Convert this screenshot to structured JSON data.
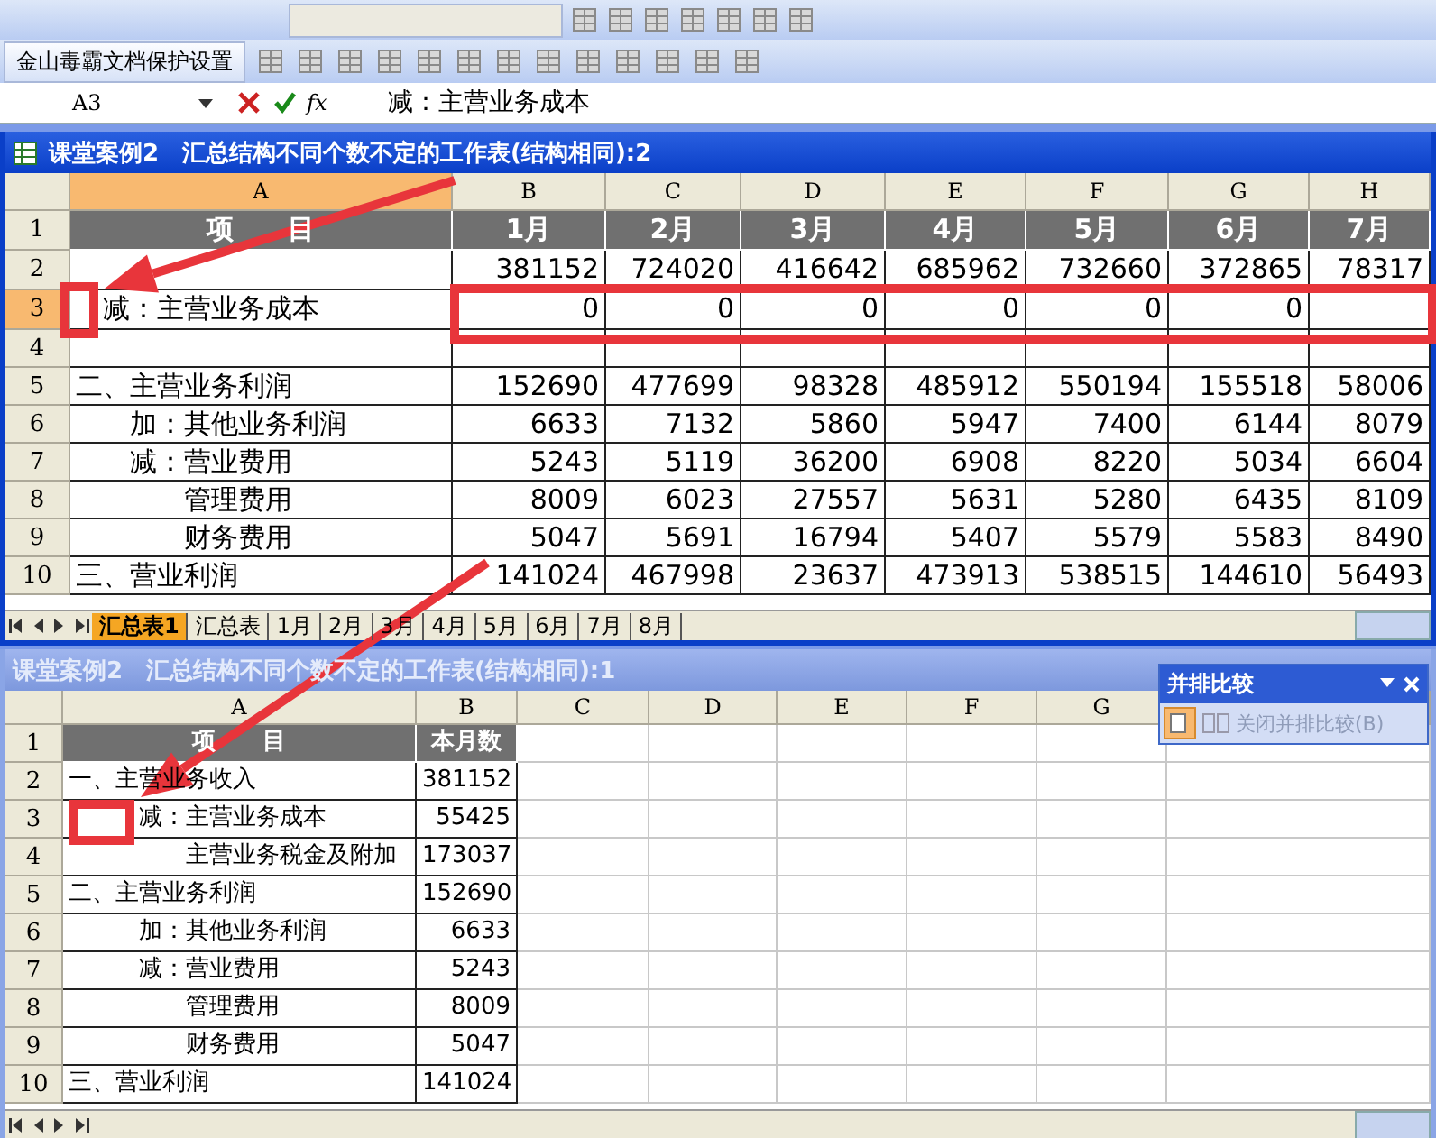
{
  "toolbar": {
    "label": "金山毒霸文档保护设置"
  },
  "formula_bar": {
    "cell_ref": "A3",
    "function_label": "fx",
    "formula": "减：主营业务成本"
  },
  "windows": [
    {
      "title": "课堂案例2　汇总结构不同个数不定的工作表(结构相同):2",
      "active": true,
      "columns": [
        {
          "label": "A",
          "selected": true
        },
        {
          "label": "B",
          "selected": false
        },
        {
          "label": "C",
          "selected": false
        },
        {
          "label": "D",
          "selected": false
        },
        {
          "label": "E",
          "selected": false
        },
        {
          "label": "F",
          "selected": false
        },
        {
          "label": "G",
          "selected": false
        },
        {
          "label": "H",
          "selected": false
        }
      ],
      "rows": [
        {
          "num": "1",
          "selected": false,
          "kind": "header",
          "cells": [
            "项　　目",
            "1月",
            "2月",
            "3月",
            "4月",
            "5月",
            "6月",
            "7月"
          ]
        },
        {
          "num": "2",
          "selected": false,
          "kind": "data",
          "cells": [
            null,
            "381152",
            "724020",
            "416642",
            "685962",
            "732660",
            "372865",
            "78317"
          ]
        },
        {
          "num": "3",
          "selected": true,
          "kind": "data",
          "cells": [
            "　减：主营业务成本",
            "0",
            "0",
            "0",
            "0",
            "0",
            "0",
            null
          ]
        },
        {
          "num": "4",
          "selected": false,
          "kind": "data",
          "cells": [
            null,
            null,
            null,
            null,
            null,
            null,
            null,
            null
          ]
        },
        {
          "num": "5",
          "selected": false,
          "kind": "data",
          "cells": [
            "二、主营业务利润",
            "152690",
            "477699",
            "98328",
            "485912",
            "550194",
            "155518",
            "58006"
          ]
        },
        {
          "num": "6",
          "selected": false,
          "kind": "data",
          "cells": [
            "　　加：其他业务利润",
            "6633",
            "7132",
            "5860",
            "5947",
            "7400",
            "6144",
            "8079"
          ]
        },
        {
          "num": "7",
          "selected": false,
          "kind": "data",
          "cells": [
            "　　减：营业费用",
            "5243",
            "5119",
            "36200",
            "6908",
            "8220",
            "5034",
            "6604"
          ]
        },
        {
          "num": "8",
          "selected": false,
          "kind": "data",
          "cells": [
            "　　　　管理费用",
            "8009",
            "6023",
            "27557",
            "5631",
            "5280",
            "6435",
            "8109"
          ]
        },
        {
          "num": "9",
          "selected": false,
          "kind": "data",
          "cells": [
            "　　　　财务费用",
            "5047",
            "5691",
            "16794",
            "5407",
            "5579",
            "5583",
            "8490"
          ]
        },
        {
          "num": "10",
          "selected": false,
          "kind": "data",
          "cells": [
            "三、营业利润",
            "141024",
            "467998",
            "23637",
            "473913",
            "538515",
            "144610",
            "56493"
          ]
        }
      ],
      "sheet_tabs": [
        {
          "label": "汇总表1",
          "selected": true
        },
        {
          "label": "汇总表",
          "selected": false
        },
        {
          "label": "1月",
          "selected": false
        },
        {
          "label": "2月",
          "selected": false
        },
        {
          "label": "3月",
          "selected": false
        },
        {
          "label": "4月",
          "selected": false
        },
        {
          "label": "5月",
          "selected": false
        },
        {
          "label": "6月",
          "selected": false
        },
        {
          "label": "7月",
          "selected": false
        },
        {
          "label": "8月",
          "selected": false
        }
      ]
    },
    {
      "title": "课堂案例2　汇总结构不同个数不定的工作表(结构相同):1",
      "active": false,
      "columns": [
        {
          "label": "A",
          "selected": false
        },
        {
          "label": "B",
          "selected": false
        },
        {
          "label": "C",
          "selected": false
        },
        {
          "label": "D",
          "selected": false
        },
        {
          "label": "E",
          "selected": false
        },
        {
          "label": "F",
          "selected": false
        },
        {
          "label": "G",
          "selected": false
        }
      ],
      "rows": [
        {
          "num": "1",
          "selected": false,
          "kind": "header",
          "cells": [
            "项　　目",
            "本月数",
            null,
            null,
            null,
            null,
            null
          ]
        },
        {
          "num": "2",
          "selected": false,
          "kind": "data",
          "cells": [
            "一、主营业务收入",
            "381152",
            null,
            null,
            null,
            null,
            null
          ]
        },
        {
          "num": "3",
          "selected": false,
          "kind": "data",
          "cells": [
            "　　　减：主营业务成本",
            "55425",
            null,
            null,
            null,
            null,
            null
          ]
        },
        {
          "num": "4",
          "selected": false,
          "kind": "data",
          "cells": [
            "　　　　　主营业务税金及附加",
            "173037",
            null,
            null,
            null,
            null,
            null
          ]
        },
        {
          "num": "5",
          "selected": false,
          "kind": "data",
          "cells": [
            "二、主营业务利润",
            "152690",
            null,
            null,
            null,
            null,
            null
          ]
        },
        {
          "num": "6",
          "selected": false,
          "kind": "data",
          "cells": [
            "　　　加：其他业务利润",
            "6633",
            null,
            null,
            null,
            null,
            null
          ]
        },
        {
          "num": "7",
          "selected": false,
          "kind": "data",
          "cells": [
            "　　　减：营业费用",
            "5243",
            null,
            null,
            null,
            null,
            null
          ]
        },
        {
          "num": "8",
          "selected": false,
          "kind": "data",
          "cells": [
            "　　　　　管理费用",
            "8009",
            null,
            null,
            null,
            null,
            null
          ]
        },
        {
          "num": "9",
          "selected": false,
          "kind": "data",
          "cells": [
            "　　　　　财务费用",
            "5047",
            null,
            null,
            null,
            null,
            null
          ]
        },
        {
          "num": "10",
          "selected": false,
          "kind": "data",
          "cells": [
            "三、营业利润",
            "141024",
            null,
            null,
            null,
            null,
            null
          ]
        }
      ]
    }
  ],
  "compare_toolbar": {
    "title": "并排比较",
    "button": "关闭并排比较(B)"
  }
}
